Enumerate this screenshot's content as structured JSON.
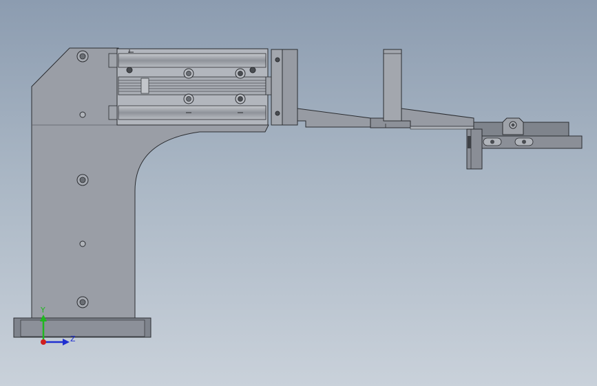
{
  "viewport": {
    "background_top": "#8c9cb0",
    "background_bottom": "#c9d1da"
  },
  "colors": {
    "part_fill": "#9a9ea6",
    "part_light": "#b4b8bf",
    "part_dark": "#7e838b",
    "edge": "#2a2c30",
    "axis_y": "#1fb81f",
    "axis_z": "#1f2fd0",
    "origin": "#d01f1f"
  },
  "triad": {
    "y_label": "Y",
    "z_label": "Z",
    "y_icon": "axis-y-arrow-icon",
    "z_icon": "axis-z-arrow-icon"
  }
}
